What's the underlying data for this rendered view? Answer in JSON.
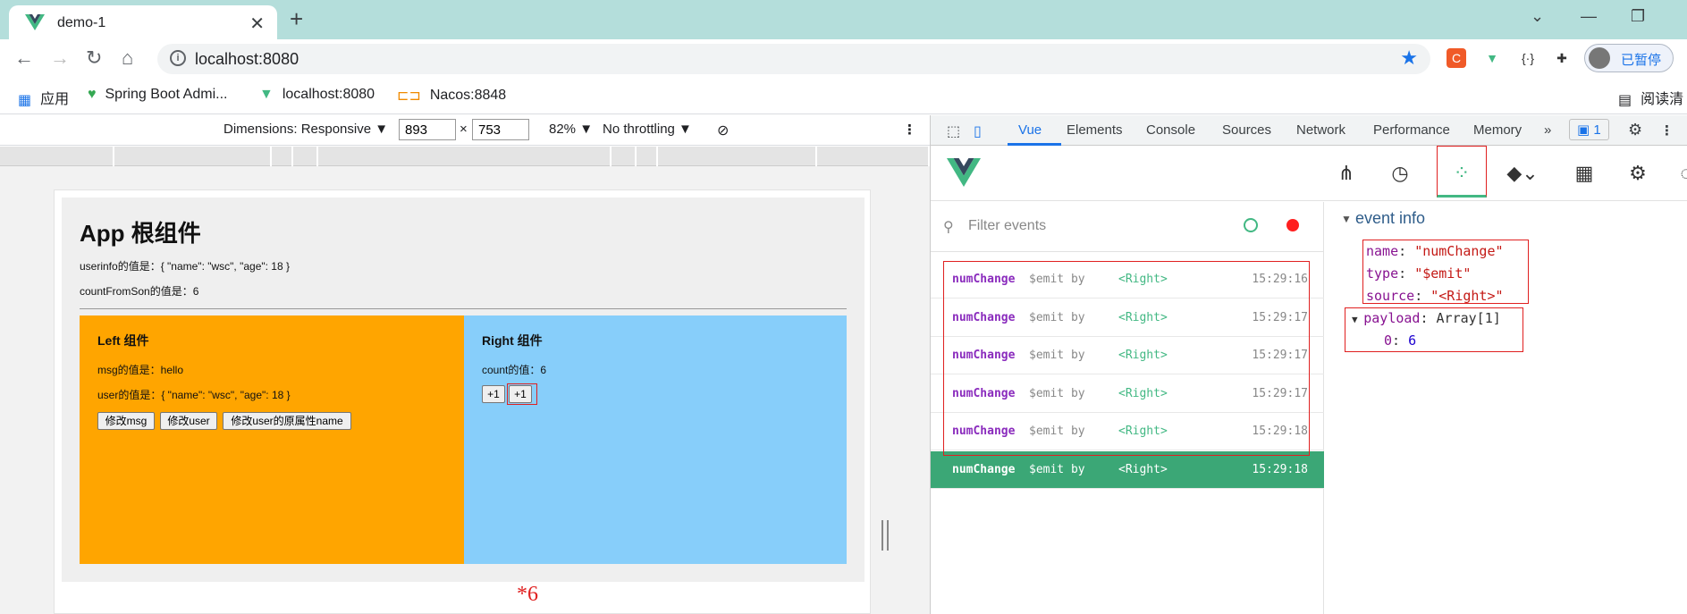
{
  "browser": {
    "tab_title": "demo-1",
    "new_tab": "+",
    "url": "localhost:8080",
    "profile_label": "已暂停",
    "reading_list": "阅读清"
  },
  "bookmarks": [
    {
      "label": "应用",
      "icon": "apps-grid-icon"
    },
    {
      "label": "Spring Boot Admi...",
      "icon": "heartbeat-icon"
    },
    {
      "label": "localhost:8080",
      "icon": "vue-logo-icon"
    },
    {
      "label": "Nacos:8848",
      "icon": "nacos-icon"
    }
  ],
  "device_toolbar": {
    "dimensions": "Dimensions: Responsive ▼",
    "width": "893",
    "times": "×",
    "height": "753",
    "zoom": "82% ▼",
    "throttling": "No throttling ▼"
  },
  "app": {
    "title": "App 根组件",
    "userinfo": "userinfo的值是：{ \"name\": \"wsc\", \"age\": 18 }",
    "countFromSon": "countFromSon的值是：6",
    "left": {
      "title": "Left 组件",
      "msg": "msg的值是：hello",
      "user": "user的值是：{ \"name\": \"wsc\", \"age\": 18 }",
      "buttons": [
        "修改msg",
        "修改user",
        "修改user的原属性name"
      ]
    },
    "right": {
      "title": "Right 组件",
      "count": "count的值：6",
      "buttons": [
        "+1",
        "+1"
      ],
      "annotation": "*6"
    }
  },
  "devtools": {
    "tabs": [
      "Vue",
      "Elements",
      "Console",
      "Sources",
      "Network",
      "Performance",
      "Memory",
      "»"
    ],
    "issues_count": "1",
    "filter_placeholder": "Filter events",
    "events": [
      {
        "name": "numChange",
        "type": "$emit by",
        "component": "<Right>",
        "time": "15:29:16"
      },
      {
        "name": "numChange",
        "type": "$emit by",
        "component": "<Right>",
        "time": "15:29:17"
      },
      {
        "name": "numChange",
        "type": "$emit by",
        "component": "<Right>",
        "time": "15:29:17"
      },
      {
        "name": "numChange",
        "type": "$emit by",
        "component": "<Right>",
        "time": "15:29:17"
      },
      {
        "name": "numChange",
        "type": "$emit by",
        "component": "<Right>",
        "time": "15:29:18"
      },
      {
        "name": "numChange",
        "type": "$emit by",
        "component": "<Right>",
        "time": "15:29:18"
      }
    ],
    "event_info": {
      "header": "event info",
      "name_key": "name",
      "name_val": "\"numChange\"",
      "type_key": "type",
      "type_val": "\"$emit\"",
      "source_key": "source",
      "source_val": "\"<Right>\"",
      "payload_key": "payload",
      "payload_val": "Array[1]",
      "item_key": "0",
      "item_val": "6"
    }
  },
  "colors": {
    "accent": "#1a73e8",
    "vue_green": "#42b883",
    "left_bg": "#ffa500",
    "right_bg": "#87cefa",
    "selected_row": "#3ba776",
    "highlight": "#e02020"
  }
}
